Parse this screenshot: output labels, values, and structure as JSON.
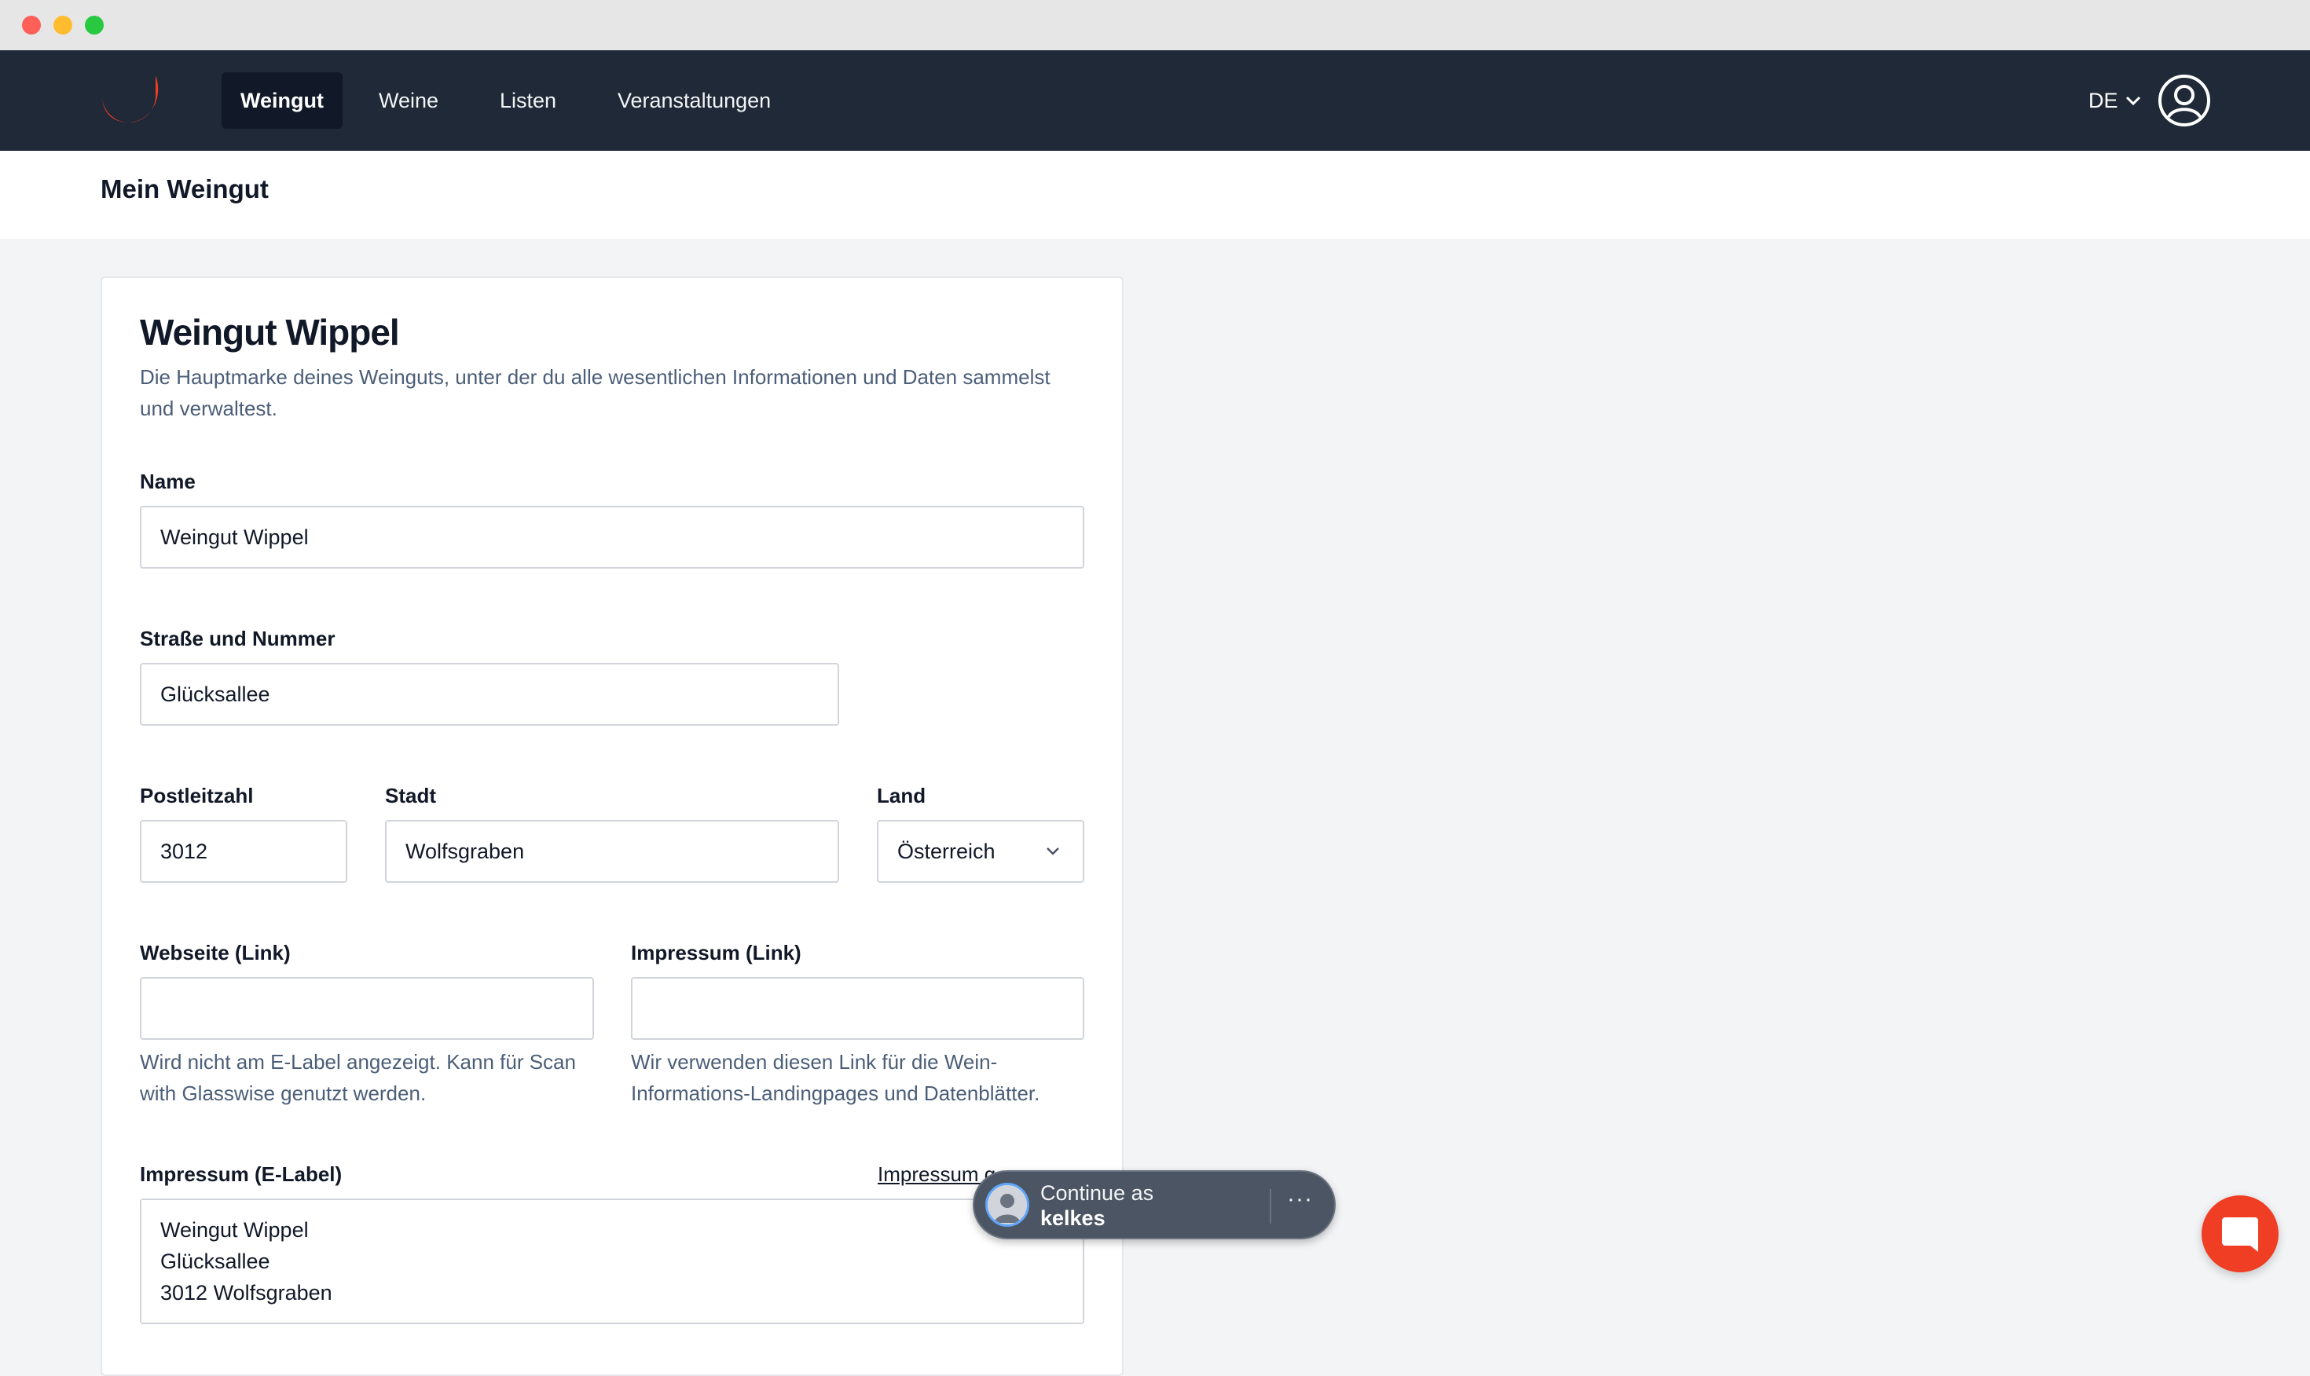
{
  "nav": {
    "items": [
      {
        "label": "Weingut",
        "active": true
      },
      {
        "label": "Weine",
        "active": false
      },
      {
        "label": "Listen",
        "active": false
      },
      {
        "label": "Veranstaltungen",
        "active": false
      }
    ],
    "language": "DE"
  },
  "page": {
    "title": "Mein Weingut"
  },
  "card": {
    "title": "Weingut Wippel",
    "description": "Die Hauptmarke deines Weinguts, unter der du alle wesentlichen Informationen und Daten sammelst und verwaltest."
  },
  "form": {
    "name": {
      "label": "Name",
      "value": "Weingut Wippel"
    },
    "street": {
      "label": "Straße und Nummer",
      "value": "Glücksallee"
    },
    "zip": {
      "label": "Postleitzahl",
      "value": "3012"
    },
    "city": {
      "label": "Stadt",
      "value": "Wolfsgraben"
    },
    "country": {
      "label": "Land",
      "value": "Österreich"
    },
    "website": {
      "label": "Webseite (Link)",
      "value": "",
      "help": "Wird nicht am E-Label angezeigt. Kann für Scan with Glasswise genutzt werden."
    },
    "imprint_link": {
      "label": "Impressum (Link)",
      "value": "",
      "help": "Wir verwenden diesen Link für die Wein-Informations-Landingpages und Datenblätter."
    },
    "imprint_elabel": {
      "label": "Impressum (E-Label)",
      "link": "Impressum g",
      "value": "Weingut Wippel\nGlücksallee\n3012 Wolfsgraben"
    }
  },
  "onetap": {
    "line1": "Continue as",
    "line2": "kelkes",
    "more": "···"
  },
  "colors": {
    "nav_bg": "#1f2937",
    "accent": "#ef3e23",
    "page_bg": "#f3f4f6"
  },
  "icons": {
    "logo": "brand-logo",
    "chevron": "chevron-down-icon",
    "user": "user-account-icon",
    "chat": "chat-icon"
  }
}
